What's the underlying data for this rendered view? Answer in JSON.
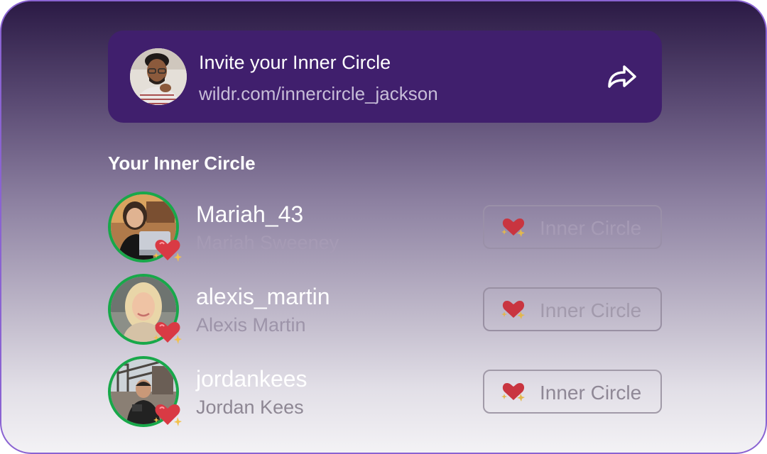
{
  "invite": {
    "title": "Invite your Inner Circle",
    "link": "wildr.com/innercircle_jackson",
    "avatar_icon": "user-avatar-photo",
    "share_icon": "share-arrow-icon"
  },
  "section_title": "Your Inner Circle",
  "members": [
    {
      "username": "Mariah_43",
      "full_name": "Mariah Sweeney",
      "button_label": "Inner Circle"
    },
    {
      "username": "alexis_martin",
      "full_name": "Alexis Martin",
      "button_label": "Inner Circle"
    },
    {
      "username": "jordankees",
      "full_name": "Jordan Kees",
      "button_label": "Inner Circle"
    }
  ],
  "colors": {
    "banner": "#401f6d",
    "avatar_ring": "#18a84a",
    "border": "#8a63d2"
  }
}
